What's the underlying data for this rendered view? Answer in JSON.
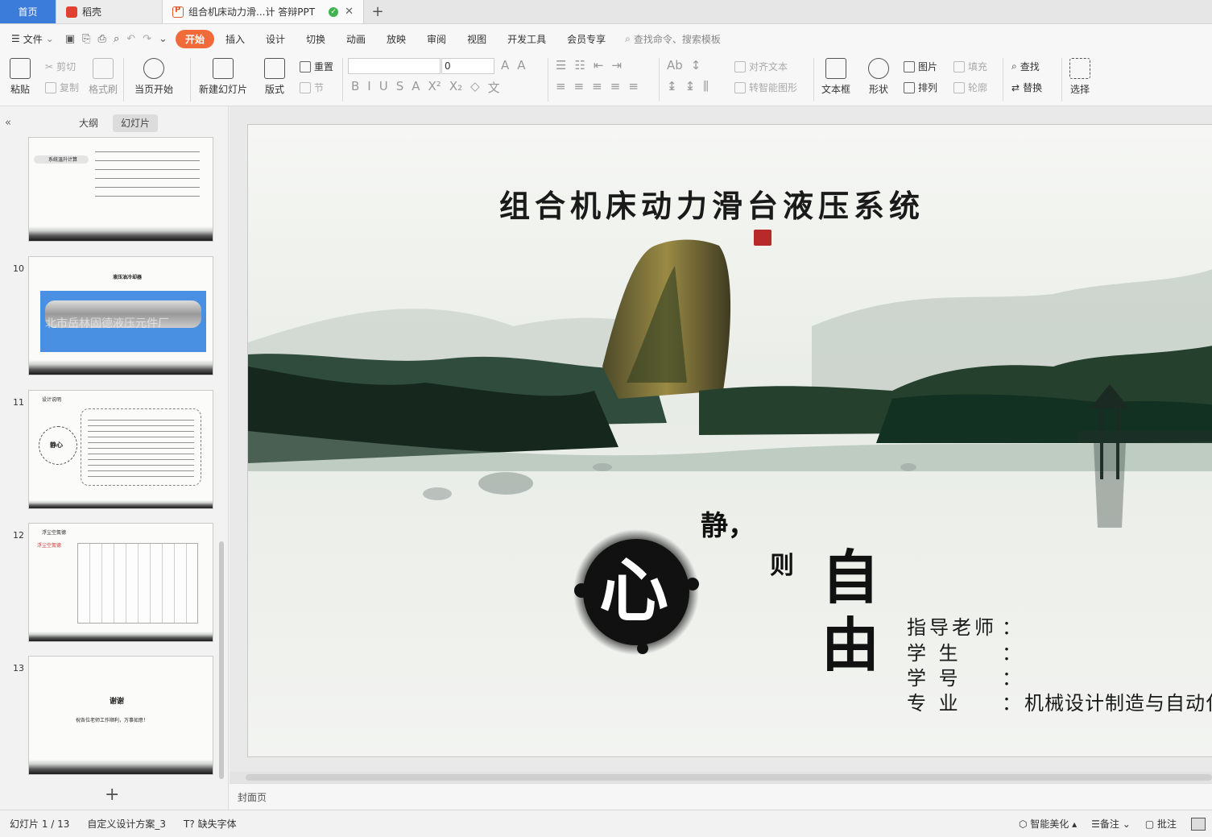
{
  "tabs": {
    "home": "首页",
    "daoke": "稻壳",
    "document": "组合机床动力滑...计 答辩PPT",
    "new_tab": "+"
  },
  "menubar": {
    "file": "文件",
    "items": [
      "开始",
      "插入",
      "设计",
      "切换",
      "动画",
      "放映",
      "审阅",
      "视图",
      "开发工具",
      "会员专享"
    ],
    "search_placeholder": "查找命令、搜索模板"
  },
  "ribbon": {
    "paste": "粘贴",
    "cut": "剪切",
    "copy": "复制",
    "format_painter": "格式刷",
    "from_current": "当页开始",
    "new_slide": "新建幻灯片",
    "layout": "版式",
    "reset": "重置",
    "section": "节",
    "font_size": "0",
    "align_text": "对齐文本",
    "smart_art": "转智能图形",
    "textbox": "文本框",
    "shape": "形状",
    "picture": "图片",
    "arrange": "排列",
    "fill": "填充",
    "outline": "轮廓",
    "find": "查找",
    "replace": "替换",
    "select": "选择"
  },
  "left_pane": {
    "tab_outline": "大纲",
    "tab_slides": "幻灯片",
    "slides": [
      {
        "number": "",
        "label": "系统温升计算"
      },
      {
        "number": "10",
        "label": "液压油冷却器",
        "watermark": "北市岳林固德液压元件厂"
      },
      {
        "number": "11",
        "label": "设计说明",
        "circle_text": "静心"
      },
      {
        "number": "12",
        "label": "浮尘空氮德",
        "side_label": "浮尘空氮德"
      },
      {
        "number": "13",
        "label": "谢谢",
        "sub": "祝各位老师工作顺利，万事如意！"
      }
    ]
  },
  "slide": {
    "title": "组合机床动力滑台液压系统",
    "motto_jing": "静，",
    "motto_ze": "则",
    "motto_xin": "心",
    "motto_ziyou": "自由",
    "info": [
      {
        "label": "指导老师",
        "colon": "：",
        "value": ""
      },
      {
        "label": "学  生",
        "colon": "：",
        "value": ""
      },
      {
        "label": "学  号",
        "colon": "：",
        "value": ""
      },
      {
        "label": "专  业",
        "colon": "：",
        "value": "机械设计制造与自动化"
      }
    ]
  },
  "notes_placeholder": "封面页",
  "statusbar": {
    "slide_counter": "幻灯片 1 / 13",
    "theme": "自定义设计方案_3",
    "missing_font": "缺失字体",
    "beautify": "智能美化",
    "notes": "备注",
    "comments": "批注"
  },
  "colors": {
    "accent": "#f06a3a",
    "home_tab": "#3b7bd9",
    "seal_red": "#b8292a"
  }
}
